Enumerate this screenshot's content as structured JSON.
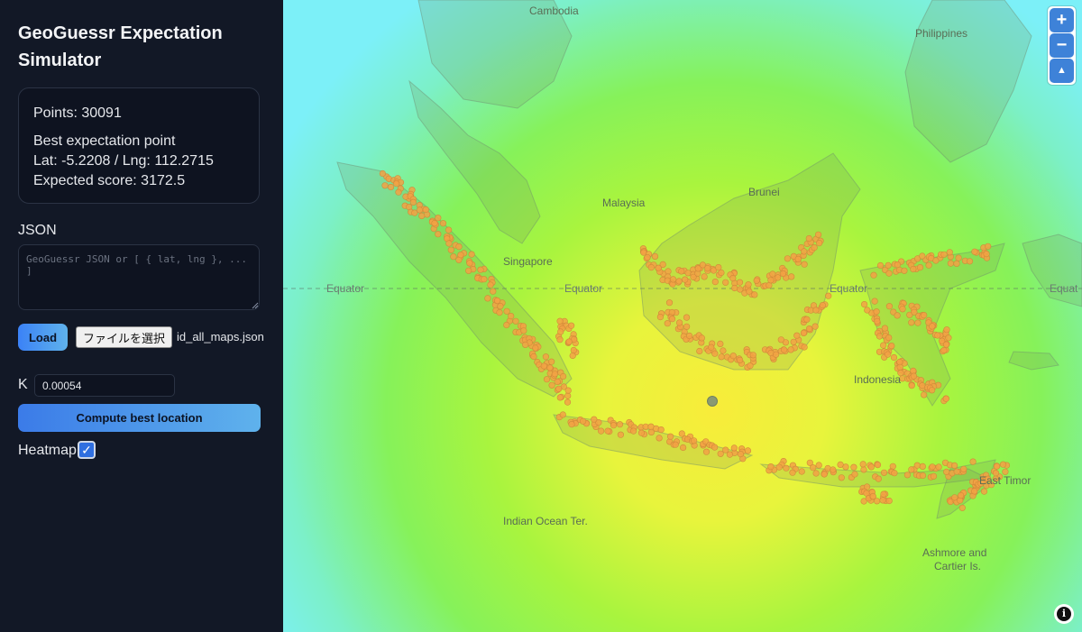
{
  "app": {
    "title": "GeoGuessr Expectation Simulator"
  },
  "stats": {
    "points": "Points: 30091",
    "best_heading": "Best expectation point",
    "latlng": "Lat: -5.2208 / Lng: 112.2715",
    "expected": "Expected score: 3172.5"
  },
  "json": {
    "label": "JSON",
    "placeholder": "GeoGuessr JSON or [ { lat, lng }, ... ]",
    "value": ""
  },
  "load": {
    "button": "Load"
  },
  "file": {
    "button": "ファイルを選択",
    "name": "id_all_maps.json"
  },
  "k": {
    "label": "K",
    "value": "0.00054"
  },
  "compute": {
    "button": "Compute best location"
  },
  "heatmap": {
    "label": "Heatmap",
    "checked": true,
    "check_glyph": "✓"
  },
  "map": {
    "labels": {
      "cambodia": "Cambodia",
      "philippines": "Philippines",
      "malaysia": "Malaysia",
      "brunei": "Brunei",
      "singapore": "Singapore",
      "equator_left": "Equator",
      "equator_mid": "Equator",
      "equator_right": "Equator",
      "equator_far": "Equat",
      "indonesia": "Indonesia",
      "east_timor": "East Timor",
      "indian_ocean": "Indian Ocean Ter.",
      "ashmore": "Ashmore and",
      "cartier": "Cartier Is."
    },
    "zoom_in": "+",
    "zoom_out": "−",
    "compass": "▲",
    "info": "i",
    "icons": {
      "zoom_in": "plus-icon",
      "zoom_out": "minus-icon",
      "compass": "compass-icon",
      "info": "info-icon"
    },
    "colors": {
      "heat_center": "#f7f33c",
      "heat_mid": "#a8f33d",
      "heat_edge": "#7cf0f5",
      "point": "#f2a244",
      "point_stroke": "#d08a3a"
    }
  }
}
